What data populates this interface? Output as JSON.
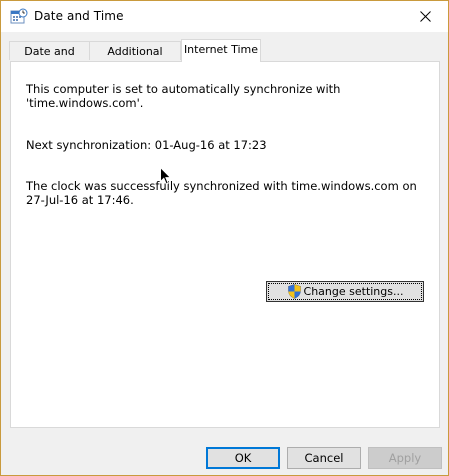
{
  "window": {
    "title": "Date and Time",
    "accent_border": "#c99a3d"
  },
  "tabs": [
    {
      "label": "Date and Time",
      "active": false
    },
    {
      "label": "Additional Clocks",
      "active": false
    },
    {
      "label": "Internet Time",
      "active": true
    }
  ],
  "panel": {
    "line1": "This computer is set to automatically synchronize with",
    "line2": "'time.windows.com'.",
    "next_sync": "Next synchronization: 01-Aug-16 at 17:23",
    "status_line1": "The clock was successfully synchronized with time.windows.com on",
    "status_line2": "27-Jul-16 at 17:46.",
    "change_settings_label": "Change settings..."
  },
  "buttons": {
    "ok": "OK",
    "cancel": "Cancel",
    "apply": "Apply"
  },
  "icons": {
    "app": "date-time-app-icon",
    "close": "close-icon",
    "shield": "uac-shield-icon",
    "cursor": "mouse-pointer-icon"
  }
}
